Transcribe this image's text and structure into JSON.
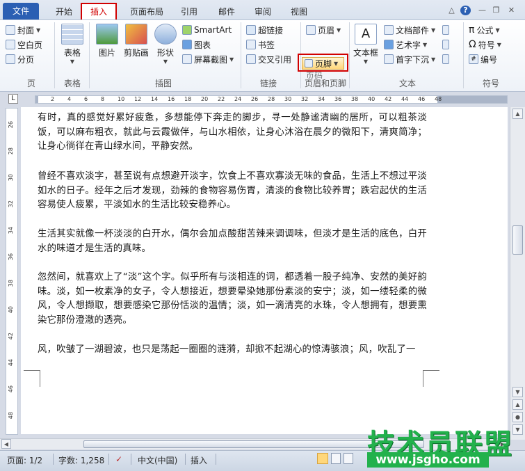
{
  "tabs": {
    "file": "文件",
    "home": "开始",
    "insert": "插入",
    "layout": "页面布局",
    "references": "引用",
    "mailings": "邮件",
    "review": "审阅",
    "view": "视图"
  },
  "ribbon": {
    "pages": {
      "cover": "封面",
      "blank": "空白页",
      "break": "分页",
      "label": "页"
    },
    "tables": {
      "table": "表格",
      "label": "表格"
    },
    "illustrations": {
      "picture": "图片",
      "clipart": "剪贴画",
      "shapes": "形状",
      "smartart": "SmartArt",
      "chart": "图表",
      "screenshot": "屏幕截图",
      "label": "插图"
    },
    "links": {
      "hyperlink": "超链接",
      "bookmark": "书签",
      "crossref": "交叉引用",
      "label": "链接"
    },
    "headerfooter": {
      "header": "页眉",
      "footer": "页脚",
      "pagenum": "页码",
      "label": "页眉和页脚"
    },
    "text": {
      "textbox": "文本框",
      "quickparts": "文档部件",
      "wordart": "艺术字",
      "dropcap": "首字下沉",
      "label": "文本"
    },
    "symbols": {
      "equation": "公式",
      "symbol": "符号",
      "number": "编号",
      "label": "符号"
    }
  },
  "ruler": {
    "corner": "L",
    "h_ticks": [
      "2",
      "4",
      "6",
      "8",
      "10",
      "12",
      "14",
      "16",
      "18",
      "20",
      "22",
      "24",
      "26",
      "28",
      "30",
      "32",
      "34",
      "36",
      "38",
      "40",
      "42",
      "44",
      "46",
      "48"
    ],
    "v_ticks": [
      "26",
      "28",
      "30",
      "32",
      "34",
      "36",
      "38",
      "40",
      "42",
      "44",
      "46",
      "48"
    ]
  },
  "document": {
    "paragraphs": [
      "有时，真的感觉好累好疲惫，多想能停下奔走的脚步，寻一处静谧清幽的居所，可以粗茶淡饭，可以麻布粗衣，就此与云霞做伴，与山水相依，让身心沐浴在晨夕的微阳下，清爽简净；让身心徜徉在青山绿水间，平静安然。",
      "曾经不喜欢淡字，甚至说有点想避开淡字，饮食上不喜欢寡淡无味的食品，生活上不想过平淡如水的日子。经年之后才发现，劲辣的食物容易伤胃，清淡的食物比较养胃；跌宕起伏的生活容易使人疲累，平淡如水的生活比较安稳养心。",
      "生活其实就像一杯淡淡的白开水，偶尔会加点酸甜苦辣来调调味，但淡才是生活的底色，白开水的味道才是生活的真味。",
      "忽然间，就喜欢上了“淡”这个字。似乎所有与淡相连的词，都透着一股子纯净、安然的美好韵味。淡，如一枚素净的女子，令人想接近，想要晕染她那份素淡的安宁；淡，如一缕轻柔的微风，令人想撷取，想要感染它那份恬淡的温情；淡，如一滴清亮的水珠，令人想拥有，想要熏染它那份澄澈的透亮。",
      "风，吹皱了一湖碧波，也只是荡起一圈圈的涟漪，却掀不起湖心的惊涛骇浪；风，吹乱了一"
    ]
  },
  "status": {
    "page": "页面: 1/2",
    "words": "字数: 1,258",
    "language": "中文(中国)",
    "mode": "插入"
  },
  "watermark": {
    "title": "技术员联盟",
    "url": "www.jsgho.com"
  },
  "colors": {
    "accent": "#2b5fb3",
    "highlight_box": "#d10000",
    "watermark": "#22b14c"
  }
}
